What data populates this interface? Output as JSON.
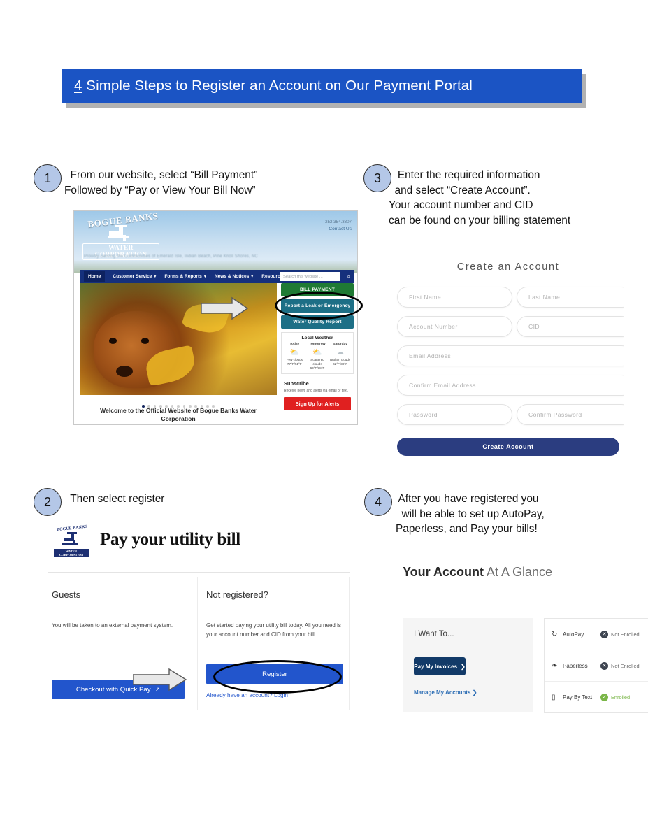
{
  "title": {
    "lead": "4",
    "rest": " Simple Steps to Register an Account on Our Payment Portal"
  },
  "steps": [
    {
      "number": "1",
      "text": "  From our website, select “Bill Payment”\nFollowed by “Pay or View Your Bill Now”"
    },
    {
      "number": "2",
      "text": "  Then select register"
    },
    {
      "number": "3",
      "text": "   Enter the required information\n  and select “Create Account”.\nYour account number and CID\ncan be found on your billing statement"
    },
    {
      "number": "4",
      "text": " After you have registered you\n  will be able to set up AutoPay,\nPaperless, and Pay your bills!"
    }
  ],
  "website": {
    "logo_name": "BOGUE BANKS",
    "logo_sub": "WATER CORPORATION",
    "phone": "252.354.3307",
    "contact_link": "Contact Us",
    "tagline": "Proudly Serving the Communities of Emerald Isle, Indian Beach, Pine Knoll Shores, NC",
    "nav": [
      {
        "label": "Home",
        "caret": false
      },
      {
        "label": "Customer Service",
        "caret": true
      },
      {
        "label": "Forms & Reports",
        "caret": true
      },
      {
        "label": "News & Notices",
        "caret": true
      },
      {
        "label": "Resources",
        "caret": true
      }
    ],
    "search_placeholder": "Search this website ...",
    "search_icon": "search-icon",
    "buttons": [
      {
        "label": "BILL PAYMENT",
        "color": "#1f7a34"
      },
      {
        "label": "Report a Leak or Emergency",
        "color": "#1d6f86"
      },
      {
        "label": "Water Quality Report",
        "color": "#1d6f86"
      }
    ],
    "weather": {
      "heading": "Local Weather",
      "days": [
        {
          "day": "Today",
          "icon": "sun-cloud-icon",
          "cond": "Few clouds",
          "temp": "77°F/51°F"
        },
        {
          "day": "Tomorrow",
          "icon": "sun-cloud-icon",
          "cond": "Scattered clouds",
          "temp": "63°F/38°F"
        },
        {
          "day": "Saturday",
          "icon": "cloud-icon",
          "cond": "Broken clouds",
          "temp": "62°F/39°F"
        }
      ]
    },
    "subscribe": {
      "heading": "Subscribe",
      "body": "Receive news and alerts via email or text.",
      "button": "Sign Up for Alerts"
    },
    "carousel_dots": 13,
    "carousel_active": 0,
    "welcome": "Welcome to the Official Website of Bogue Banks Water Corporation"
  },
  "portal": {
    "logo_name": "BOGUE BANKS",
    "logo_sub": "WATER CORPORATION",
    "title": "Pay your utility bill",
    "guests": {
      "heading": "Guests",
      "body": "You will be taken to an external payment system.",
      "button": "Checkout with Quick Pay",
      "button_icon": "external-link-icon"
    },
    "register": {
      "heading": "Not registered?",
      "body": "Get started paying your utility bill today. All you need is your account number and CID from your bill.",
      "button": "Register",
      "login_link": "Already have an account? Login"
    }
  },
  "create_account": {
    "heading": "Create an Account",
    "fields": [
      {
        "placeholder": "First Name"
      },
      {
        "placeholder": "Last Name"
      },
      {
        "placeholder": "Account Number"
      },
      {
        "placeholder": "CID"
      },
      {
        "placeholder": "Email Address"
      },
      {
        "placeholder": "Confirm Email Address"
      },
      {
        "placeholder": "Password"
      },
      {
        "placeholder": "Confirm Password"
      }
    ],
    "submit": "Create Account"
  },
  "glance": {
    "title_bold": "Your Account",
    "title_light": " At A Glance",
    "card_heading": "I Want To...",
    "pay_button": "Pay My Invoices",
    "pay_button_icon": "chevron-right-icon",
    "manage_link": "Manage My Accounts",
    "manage_link_icon": "chevron-right-icon",
    "rows": [
      {
        "icon": "autopay-refresh-icon",
        "label": "AutoPay",
        "status": "Not Enrolled",
        "enrolled": false
      },
      {
        "icon": "paperless-leaf-icon",
        "label": "Paperless",
        "status": "Not Enrolled",
        "enrolled": false
      },
      {
        "icon": "mobile-phone-icon",
        "label": "Pay By Text",
        "status": "Enrolled",
        "enrolled": true
      }
    ]
  },
  "colors": {
    "banner_blue": "#1b54c4",
    "step_circle": "#b4c7e7",
    "bill_payment_green": "#1f7a34",
    "teal": "#1d6f86",
    "alert_red": "#e02020",
    "portal_blue": "#2255cc",
    "create_navy": "#2b3d80",
    "pay_navy": "#123a68",
    "enrolled_green": "#7ab648",
    "not_enrolled_gray": "#3d4450"
  }
}
